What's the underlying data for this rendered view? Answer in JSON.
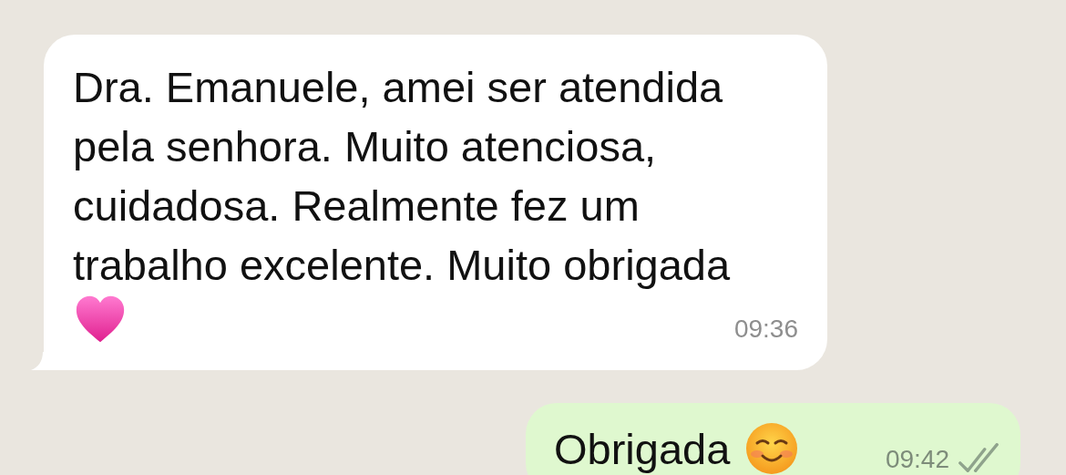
{
  "messages": [
    {
      "kind": "incoming",
      "text": "Dra. Emanuele, amei ser atendida pela senhora. Muito atenciosa, cuidadosa. Realmente fez um trabalho excelente. Muito obrigada",
      "emoji": {
        "kind": "heart"
      },
      "time": "09:36"
    },
    {
      "kind": "outgoing",
      "text": "Obrigada",
      "emoji": {
        "kind": "smile"
      },
      "time": "09:42",
      "read": false
    }
  ]
}
